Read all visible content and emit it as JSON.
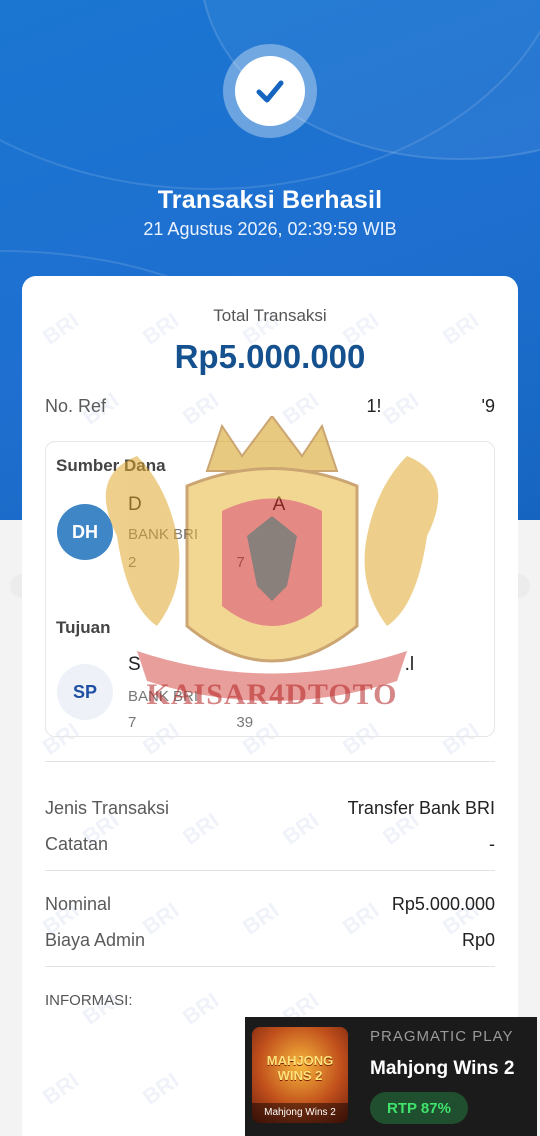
{
  "header": {
    "title": "Transaksi Berhasil",
    "datetime": "21 Agustus 2026, 02:39:59 WIB"
  },
  "summary": {
    "total_label": "Total Transaksi",
    "total_amount": "Rp5.000.000",
    "ref_label": "No. Ref",
    "ref_value": "1!                    '9"
  },
  "watermark": {
    "text": "BRI",
    "emblem_text": "KAISAR4DTOTO"
  },
  "source": {
    "title": "Sumber Dana",
    "initials": "DH",
    "name": "D                         A",
    "bank": "BANK BRI",
    "account": "2                        7"
  },
  "destination": {
    "title": "Tujuan",
    "initials": "SP",
    "name": "S                                                  .l",
    "bank": "BANK BRI",
    "account": "7                        39"
  },
  "details": {
    "type_label": "Jenis Transaksi",
    "type_value": "Transfer Bank BRI",
    "note_label": "Catatan",
    "note_value": "-",
    "nominal_label": "Nominal",
    "nominal_value": "Rp5.000.000",
    "fee_label": "Biaya Admin",
    "fee_value": "Rp0",
    "info_label": "INFORMASI:"
  },
  "promo": {
    "thumb_title": "MAHJONG WINS 2",
    "thumb_caption": "Mahjong Wins 2",
    "provider": "PRAGMATIC PLAY",
    "game": "Mahjong Wins 2",
    "rtp": "RTP 87%"
  },
  "colors": {
    "primary_blue": "#1a76d1",
    "amount_blue": "#15508f",
    "rtp_green": "#3fe36c"
  }
}
